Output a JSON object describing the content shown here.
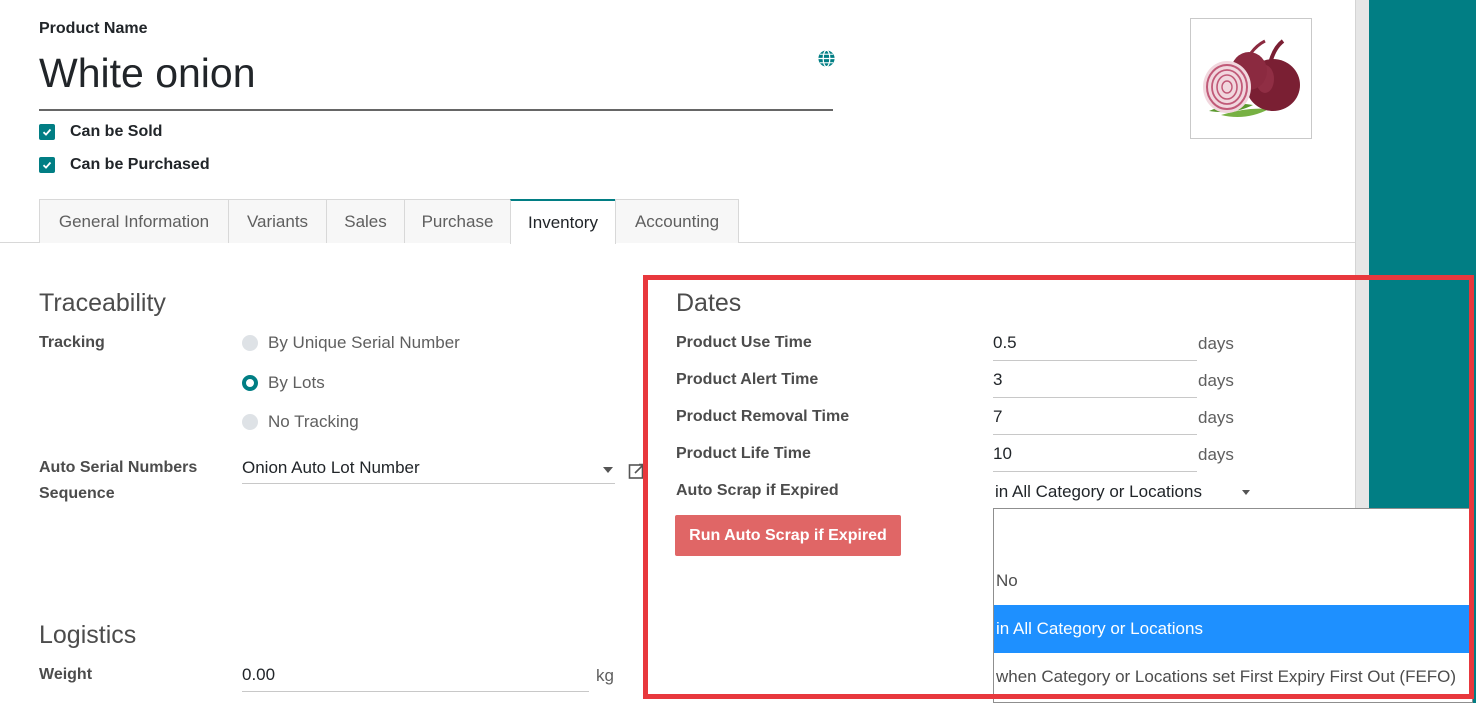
{
  "header": {
    "product_name_label": "Product Name",
    "product_name": "White onion",
    "can_be_sold": "Can be Sold",
    "can_be_purchased": "Can be Purchased"
  },
  "tabs": [
    {
      "label": "General Information"
    },
    {
      "label": "Variants"
    },
    {
      "label": "Sales"
    },
    {
      "label": "Purchase"
    },
    {
      "label": "Inventory"
    },
    {
      "label": "Accounting"
    }
  ],
  "active_tab": "Inventory",
  "traceability": {
    "title": "Traceability",
    "tracking_label": "Tracking",
    "options": [
      "By Unique Serial Number",
      "By Lots",
      "No Tracking"
    ],
    "selected": "By Lots",
    "auto_serial_label_line1": "Auto Serial Numbers",
    "auto_serial_label_line2": "Sequence",
    "auto_serial_value": "Onion Auto Lot Number"
  },
  "logistics": {
    "title": "Logistics",
    "weight_label": "Weight",
    "weight_value": "0.00",
    "weight_unit": "kg"
  },
  "dates": {
    "title": "Dates",
    "fields": [
      {
        "label": "Product Use Time",
        "value": "0.5",
        "unit": "days"
      },
      {
        "label": "Product Alert Time",
        "value": "3",
        "unit": "days"
      },
      {
        "label": "Product Removal Time",
        "value": "7",
        "unit": "days"
      },
      {
        "label": "Product Life Time",
        "value": "10",
        "unit": "days"
      }
    ],
    "auto_scrap_label": "Auto Scrap if Expired",
    "auto_scrap_value": "in All Category or Locations",
    "run_button": "Run Auto Scrap if Expired",
    "dropdown_options": [
      "",
      "No",
      "in All Category or Locations",
      "when Category or Locations set First Expiry First Out (FEFO)"
    ],
    "dropdown_selected_index": 2
  },
  "colors": {
    "accent": "#017e84",
    "highlight_box": "#e8383d",
    "run_button": "#e06666",
    "dropdown_selected": "#1e90ff"
  }
}
